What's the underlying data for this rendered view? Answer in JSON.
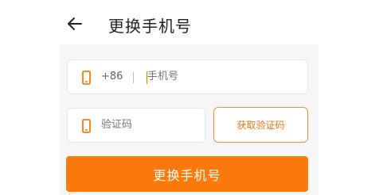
{
  "header": {
    "title": "更换手机号",
    "back_icon": "arrow-left-icon"
  },
  "phone_field": {
    "prefix": "+86",
    "separator": "|",
    "placeholder": "手机号",
    "icon": "mobile-phone-icon"
  },
  "code_field": {
    "placeholder": "验证码",
    "icon": "mobile-phone-icon"
  },
  "buttons": {
    "get_code": "获取验证码",
    "submit": "更换手机号"
  },
  "colors": {
    "accent": "#fb7a0c",
    "accent_border": "#f09240",
    "panel_bg": "#f6f6f6"
  }
}
